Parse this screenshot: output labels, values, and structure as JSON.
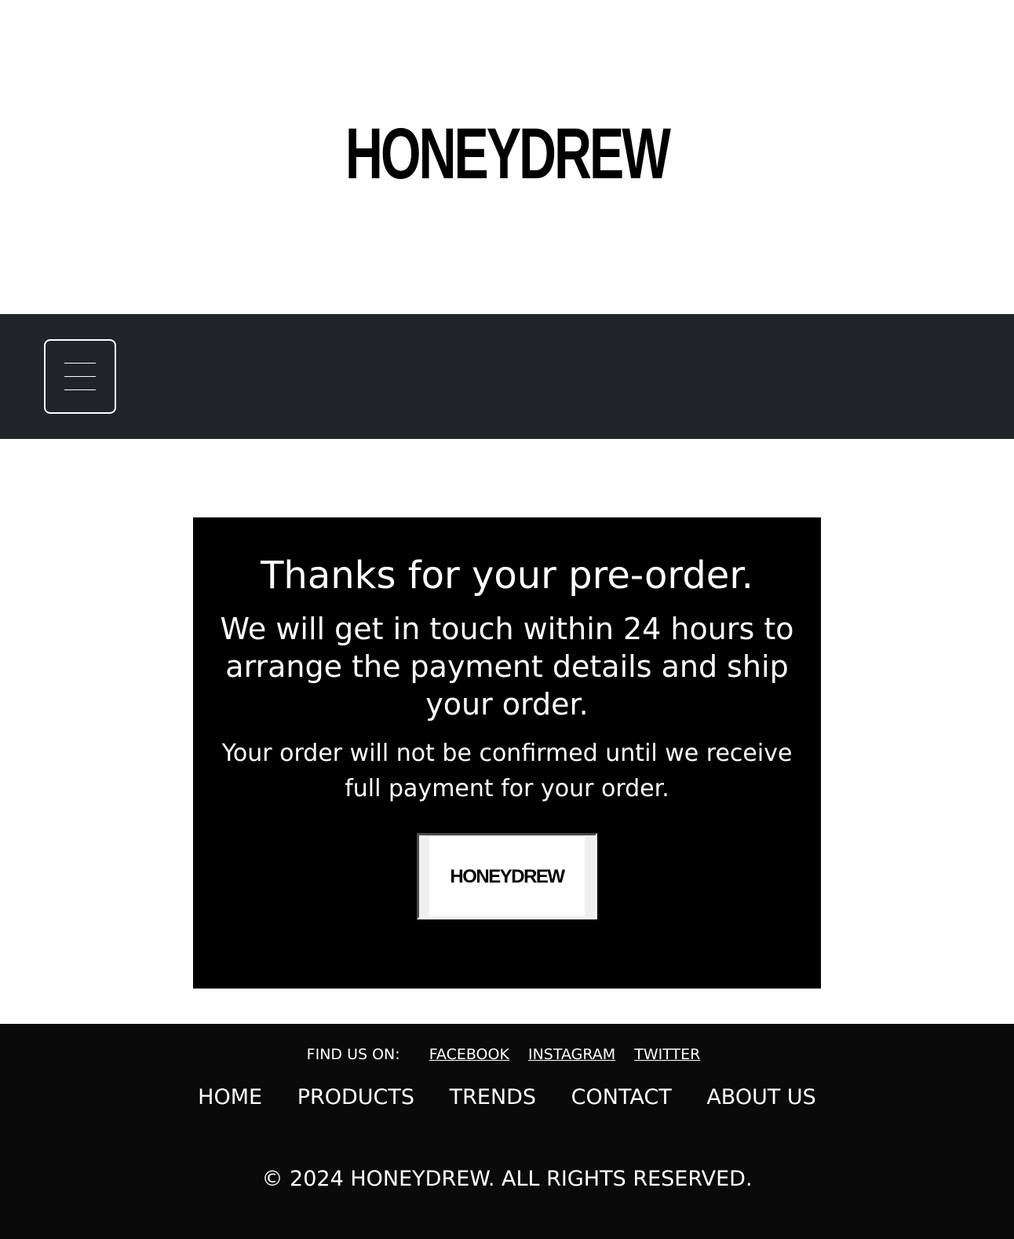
{
  "header": {
    "logo_text": "HONEYDREW"
  },
  "navbar": {
    "menu_icon": "hamburger-icon"
  },
  "confirmation": {
    "title": "Thanks for your pre-order.",
    "subtitle": "We will get in touch within 24 hours to arrange the payment details and ship your order.",
    "notice": "Your order will not be confirmed until we receive full payment for your order.",
    "logo_button_text": "HONEYDREW"
  },
  "footer": {
    "find_us_label": "FIND US ON:",
    "social_links": [
      "FACEBOOK",
      "INSTAGRAM",
      "TWITTER"
    ],
    "nav_links": [
      "HOME",
      "PRODUCTS",
      "TRENDS",
      "CONTACT",
      "ABOUT US"
    ],
    "copyright": "© 2024 HONEYDREW. ALL RIGHTS RESERVED."
  }
}
